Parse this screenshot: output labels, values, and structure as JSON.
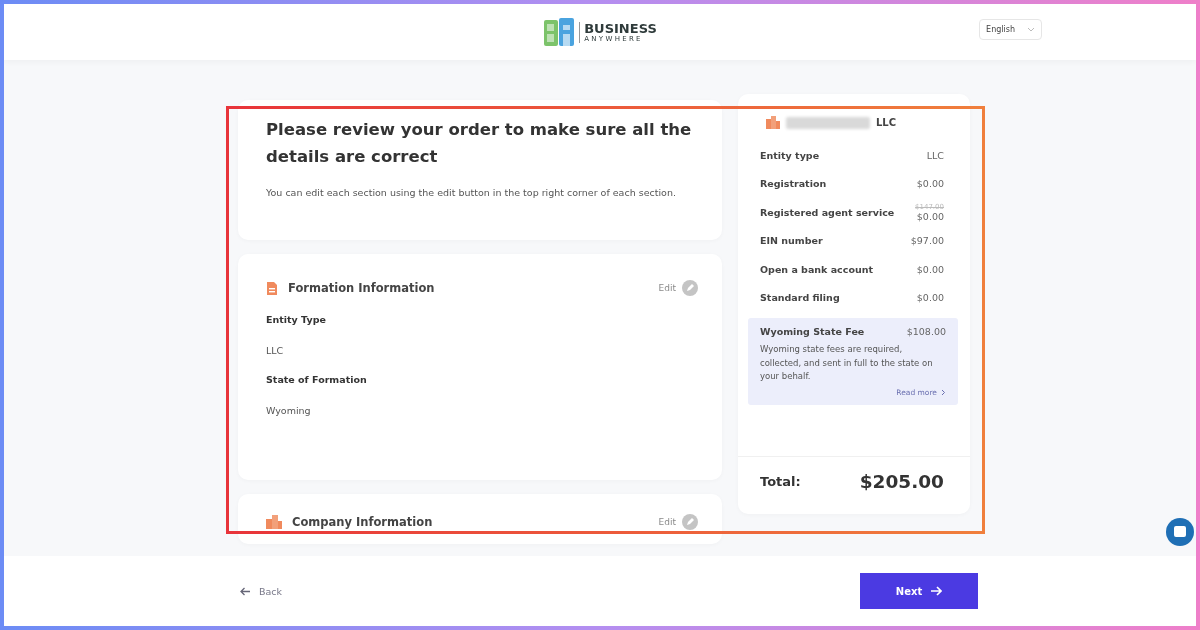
{
  "header": {
    "logo_top": "BUSINESS",
    "logo_bottom": "ANYWHERE",
    "language": "English"
  },
  "intro": {
    "title": "Please review your order to make sure all the details are correct",
    "text": "You can edit each section using the edit button in the top right corner of each section."
  },
  "sections": [
    {
      "kind": "document",
      "title": "Formation Information",
      "edit": "Edit",
      "fields": [
        {
          "label": "Entity Type",
          "value": "LLC"
        },
        {
          "label": "State of Formation",
          "value": "Wyoming"
        }
      ]
    },
    {
      "kind": "building",
      "title": "Company Information",
      "edit": "Edit"
    }
  ],
  "summary": {
    "name_suffix": "LLC",
    "rows": [
      {
        "label": "Entity type",
        "value": "LLC"
      },
      {
        "label": "Registration",
        "value": "$0.00"
      },
      {
        "label": "Registered agent service",
        "old_value": "$147.00",
        "value": "$0.00"
      },
      {
        "label": "EIN number",
        "value": "$97.00"
      },
      {
        "label": "Open a bank account",
        "value": "$0.00"
      },
      {
        "label": "Standard filing",
        "value": "$0.00"
      }
    ],
    "state_fee": {
      "title": "Wyoming State Fee",
      "amount": "$108.00",
      "text": "Wyoming state fees are required, collected, and sent in full to the state on your behalf.",
      "link": "Read more"
    },
    "total_label": "Total:",
    "total": "$205.00"
  },
  "footer": {
    "back": "Back",
    "next": "Next"
  }
}
